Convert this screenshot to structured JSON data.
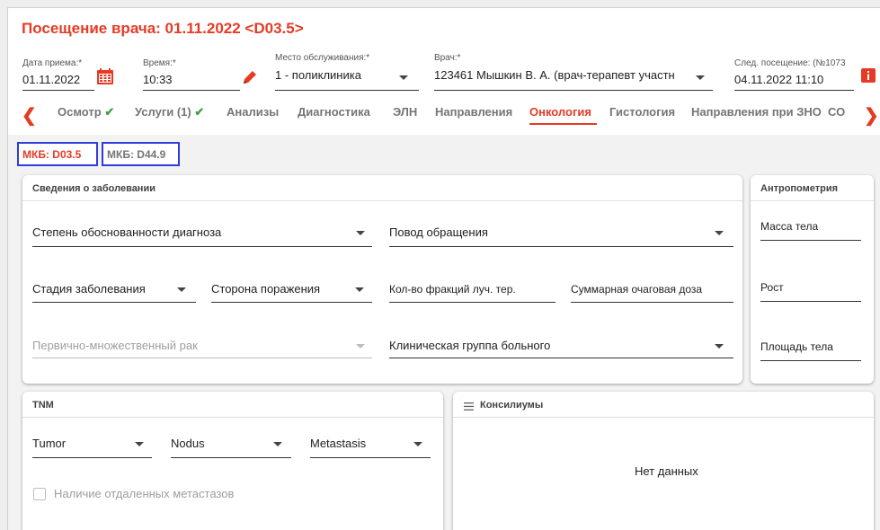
{
  "page": {
    "title": "Посещение врача: 01.11.2022 <D03.5>"
  },
  "fields": {
    "visit_date": {
      "label": "Дата приема:*",
      "value": "01.11.2022"
    },
    "visit_time": {
      "label": "Время:*",
      "value": "10:33"
    },
    "service_place": {
      "label": "Место обслуживания:*",
      "value": "1 - поликлиника"
    },
    "doctor": {
      "label": "Врач:*",
      "value": "123461 Мышкин В. А. (врач-терапевт участн"
    },
    "next_visit": {
      "label": "След. посещение: (№1073",
      "value": "04.11.2022 11:10"
    }
  },
  "tabs": [
    {
      "label": "Осмотр",
      "check": "✔"
    },
    {
      "label": "Услуги (1)",
      "check": "✔"
    },
    {
      "label": "Анализы"
    },
    {
      "label": "Диагностика"
    },
    {
      "label": "ЭЛН"
    },
    {
      "label": "Направления"
    },
    {
      "label": "Онкология",
      "active": true
    },
    {
      "label": "Гистология"
    },
    {
      "label": "Направления при ЗНО"
    },
    {
      "label": "СО"
    }
  ],
  "mkb": [
    {
      "label": "МКБ: D03.5",
      "active": true
    },
    {
      "label": "МКБ: D44.9"
    }
  ],
  "disease_info": {
    "title": "Сведения о заболевании",
    "diagnosis_validity": "Степень обоснованности диагноза",
    "visit_reason": "Повод обращения",
    "disease_stage": "Стадия заболевания",
    "lesion_side": "Сторона поражения",
    "radiation_fractions": "Кол-во фракций луч. тер.",
    "total_focal_dose": "Суммарная очаговая доза",
    "multiple_primary_cancer": "Первично-множественный рак",
    "clinical_group": "Клиническая группа больного"
  },
  "anthropometry": {
    "title": "Антропометрия",
    "body_mass": "Масса тела",
    "height": "Рост",
    "body_area": "Площадь тела"
  },
  "tnm": {
    "title": "TNM",
    "tumor": "Tumor",
    "nodus": "Nodus",
    "metastasis": "Metastasis",
    "distant_metastases": "Наличие отдаленных метастазов"
  },
  "consilium": {
    "title": "Консилиумы",
    "empty": "Нет данных"
  },
  "colors": {
    "accent": "#e53b25",
    "mkb_outline": "#2f3bdc",
    "check": "#43a047"
  }
}
